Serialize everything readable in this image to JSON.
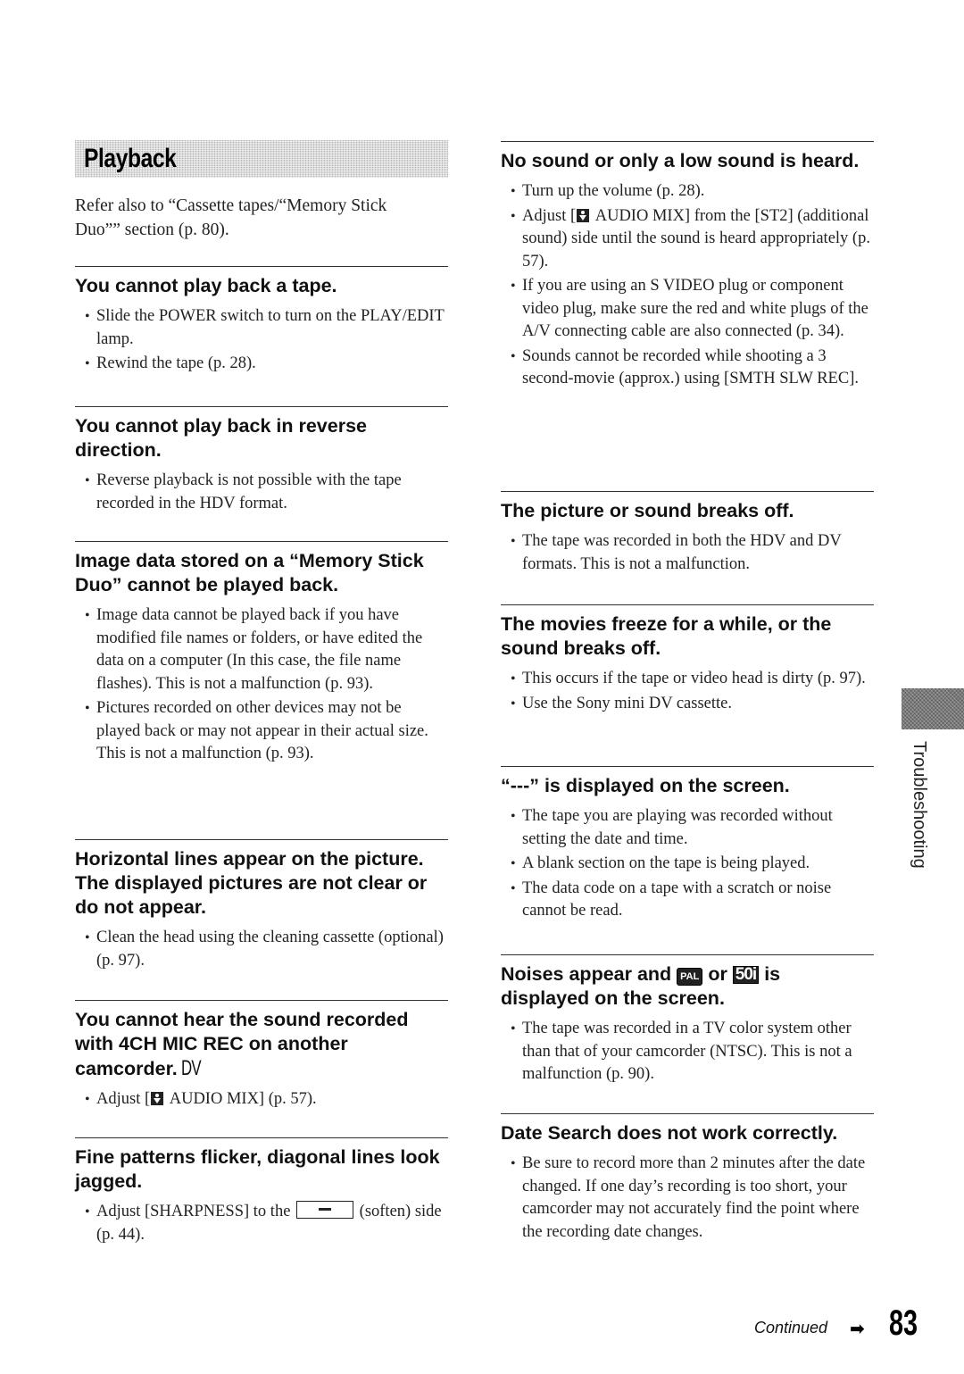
{
  "section": {
    "title": "Playback",
    "intro": "Refer also to “Cassette tapes/“Memory Stick Duo”” section (p. 80)."
  },
  "left_column": [
    {
      "heading": "You cannot play back a tape.",
      "items": [
        "Slide the POWER switch to turn on the PLAY/EDIT lamp.",
        "Rewind the tape (p. 28)."
      ]
    },
    {
      "heading": "You cannot play back in reverse direction.",
      "items": [
        "Reverse playback is not possible with the tape recorded in the HDV format."
      ]
    },
    {
      "heading": "Image data stored on a “Memory Stick Duo” cannot be played back.",
      "items": [
        "Image data cannot be played back if you have modified file names or folders, or have edited the data on a computer (In this case, the file name flashes). This is not a malfunction (p. 93).",
        "Pictures recorded on other devices may not be played back or may not appear in their actual size. This is not a malfunction (p. 93)."
      ]
    },
    {
      "heading": "Horizontal lines appear on the picture. The displayed pictures are not clear or do not appear.",
      "items": [
        "Clean the head using the cleaning cassette (optional) (p. 97)."
      ]
    },
    {
      "heading": "You cannot hear the sound recorded with 4CH MIC REC on another camcorder.",
      "heading_badge": "DV",
      "items_rich": [
        {
          "pre": "Adjust [",
          "icon": "audio-mix-icon",
          "post": " AUDIO MIX] (p. 57)."
        }
      ]
    },
    {
      "heading": "Fine patterns flicker, diagonal lines look jagged.",
      "items_rich": [
        {
          "pre": "Adjust [SHARPNESS] to the ",
          "icon": "soften-icon",
          "post": " (soften) side (p. 44)."
        }
      ]
    }
  ],
  "right_column": [
    {
      "heading": "No sound or only a low sound is heard.",
      "items": [
        "Turn up the volume (p. 28)."
      ],
      "items_rich": [
        {
          "pre": "Adjust [",
          "icon": "audio-mix-icon",
          "post": " AUDIO MIX] from the [ST2] (additional sound) side until the sound is heard appropriately (p. 57)."
        }
      ],
      "items_after": [
        "If you are using an S VIDEO plug or component video plug, make sure the red and white plugs of the A/V connecting cable are also connected (p. 34).",
        "Sounds cannot be recorded while shooting a 3 second-movie (approx.) using [SMTH SLW REC]."
      ]
    },
    {
      "heading": "The picture or sound breaks off.",
      "items": [
        "The tape was recorded in both the HDV and DV formats. This is not a malfunction."
      ]
    },
    {
      "heading": "The movies freeze for a while, or the sound breaks off.",
      "items": [
        "This occurs if the tape or video head is dirty (p. 97).",
        "Use the Sony mini DV cassette."
      ]
    },
    {
      "heading": "“---” is displayed on the screen.",
      "items": [
        "The tape you are playing was recorded without setting the date and time.",
        "A blank section on the tape is being played.",
        "The data code on a tape with a scratch or noise cannot be read."
      ]
    },
    {
      "heading_parts": {
        "pre": "Noises appear and ",
        "badge1": "PAL",
        "mid": " or ",
        "badge2": "50i",
        "post": " is displayed on the screen."
      },
      "items": [
        "The tape was recorded in a TV color system other than that of your camcorder (NTSC). This is not a malfunction (p. 90)."
      ]
    },
    {
      "heading": "Date Search does not work correctly.",
      "items": [
        "Be sure to record more than 2 minutes after the date changed. If one day’s recording is too short, your camcorder may not accurately find the point where the recording date changes."
      ]
    }
  ],
  "side_tab": {
    "label": "Troubleshooting"
  },
  "footer": {
    "continued": "Continued",
    "arrow": "➡",
    "page_number": "83"
  }
}
